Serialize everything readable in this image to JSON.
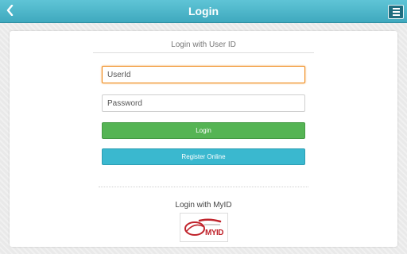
{
  "header": {
    "title": "Login",
    "back_icon": "chevron-left-icon",
    "menu_icon": "hamburger-menu-icon",
    "color": "#4ab6ca"
  },
  "login": {
    "section_title": "Login with User ID",
    "userid_placeholder": "UserId",
    "password_placeholder": "Password",
    "login_button": "Login",
    "register_button": "Register Online",
    "login_button_color": "#55b454",
    "register_button_color": "#3ab8cf",
    "focus_color": "#f08c1e"
  },
  "myid": {
    "title": "Login with MyID",
    "logo_label": "MYID",
    "logo_text_arabic": "هويتي",
    "logo_color": "#c0242c"
  }
}
